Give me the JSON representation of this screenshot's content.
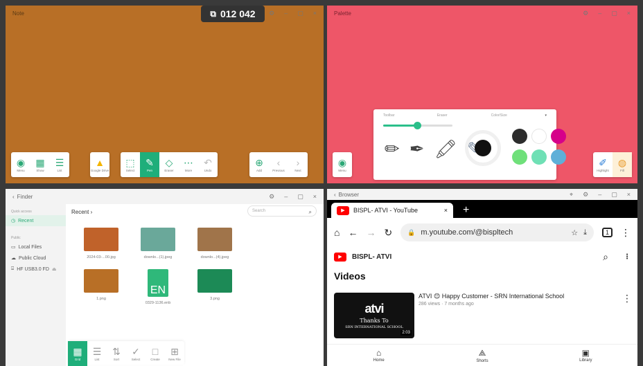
{
  "counter": {
    "icon": "screen-icon",
    "value": "012 042"
  },
  "note": {
    "title": "Note",
    "toolbar_left": [
      {
        "icon": "menu-icon",
        "glyph": "◉",
        "label": "Menu"
      },
      {
        "icon": "grid-icon",
        "glyph": "▦",
        "label": "Show"
      },
      {
        "icon": "list-icon",
        "glyph": "☰",
        "label": "List"
      }
    ],
    "toolbar_drive": {
      "icon": "drive-icon",
      "glyph": "▲",
      "label": "Google Drive"
    },
    "toolbar_mid": [
      {
        "icon": "select-icon",
        "glyph": "⬚",
        "label": "Select",
        "active": false
      },
      {
        "icon": "pen-icon",
        "glyph": "✎",
        "label": "Pen",
        "active": true
      },
      {
        "icon": "eraser-icon",
        "glyph": "◇",
        "label": "Eraser",
        "active": false
      },
      {
        "icon": "more-icon",
        "glyph": "⋯",
        "label": "More",
        "active": false
      },
      {
        "icon": "undo-icon",
        "glyph": "↶",
        "label": "Undo",
        "active": false
      }
    ],
    "toolbar_right": [
      {
        "icon": "add-page-icon",
        "glyph": "⊕",
        "label": "Add"
      },
      {
        "icon": "previous-icon",
        "glyph": "‹",
        "label": "Previous"
      },
      {
        "icon": "next-icon",
        "glyph": "›",
        "label": "Next"
      }
    ]
  },
  "palette": {
    "title": "Palette",
    "menu_label": "Menu",
    "panel_headers": [
      "Toolbar",
      "Eraser",
      "Color/Size"
    ],
    "slider_fraction": 0.49,
    "swatches": [
      "#2d2d2d",
      "#ffffff",
      "#d6008a",
      "#6fe07a",
      "#6fe0b5",
      "#5fb0d8"
    ],
    "right_tools": [
      {
        "icon": "highlighter-icon",
        "glyph": "✐",
        "label": "Highlight"
      },
      {
        "icon": "fill-icon",
        "glyph": "◍",
        "label": "Fill"
      }
    ]
  },
  "finder": {
    "title": "Finder",
    "quick_access": "Quick access",
    "recent": "Recent",
    "public_label": "Public",
    "sidebar_items": [
      "Local Files",
      "Public Cloud",
      "HF USB3.0 FD"
    ],
    "breadcrumb": "Recent ›",
    "search_placeholder": "Search",
    "files": [
      {
        "name": "2024-03-...00.jpg",
        "color": "#c0622a"
      },
      {
        "name": "downlo...(1).jpeg",
        "color": "#6aa89a"
      },
      {
        "name": "downlo...(4).jpeg",
        "color": "#a0744a"
      },
      {
        "name": "1.png",
        "color": "#b86f26"
      },
      {
        "name": "0329-1136.enb",
        "color": "#2fb87a"
      },
      {
        "name": "3.png",
        "color": "#1c8a56"
      }
    ],
    "en_badge": "EN",
    "bottom_tools": [
      {
        "icon": "grid-view-icon",
        "glyph": "▦",
        "label": "Grid",
        "active": true
      },
      {
        "icon": "list-view-icon",
        "glyph": "☰",
        "label": "List",
        "active": false
      },
      {
        "icon": "sort-icon",
        "glyph": "⇅",
        "label": "Sort",
        "active": false
      },
      {
        "icon": "select-all-icon",
        "glyph": "✓",
        "label": "Select",
        "active": false
      },
      {
        "icon": "create-folder-icon",
        "glyph": "□",
        "label": "Create",
        "active": false
      },
      {
        "icon": "new-file-icon",
        "glyph": "⊞",
        "label": "New File",
        "active": false
      }
    ]
  },
  "browser": {
    "title": "Browser",
    "tab_title": "BISPL- ATVI - YouTube",
    "url": "m.youtube.com/@bispltech",
    "tab_count": "1",
    "channel": "BISPL- ATVI",
    "videos_heading": "Videos",
    "video": {
      "title": "ATVI 😊 Happy Customer - SRN International School",
      "meta": "286 views · 7 months ago",
      "thumb_logo": "atvi",
      "thumb_line1": "Thanks To",
      "thumb_line2": "SRN INTERNATIONAL SCHOOL",
      "duration": "2:03"
    },
    "nav": [
      {
        "icon": "home-icon",
        "glyph": "⌂",
        "label": "Home"
      },
      {
        "icon": "shorts-icon",
        "glyph": "⟁",
        "label": "Shorts"
      },
      {
        "icon": "library-icon",
        "glyph": "▣",
        "label": "Library"
      }
    ]
  }
}
